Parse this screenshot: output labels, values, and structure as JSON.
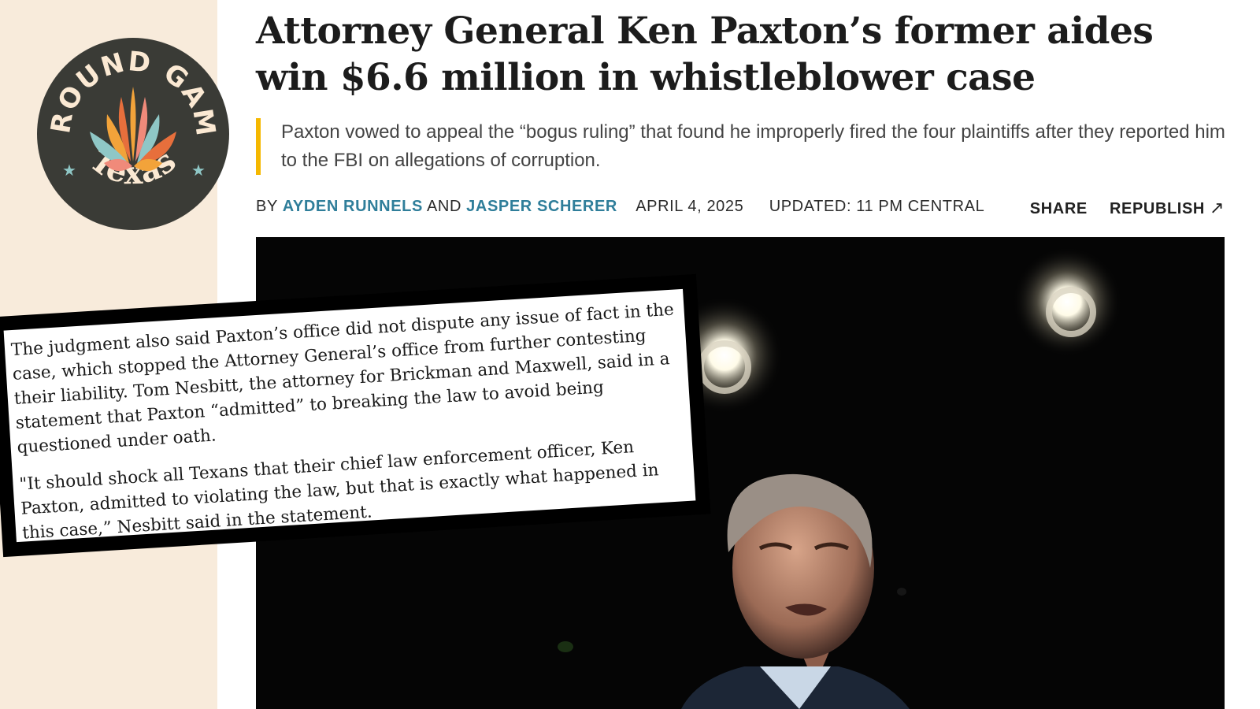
{
  "brand": {
    "logo_top_text": "GROUND GAME",
    "logo_bottom_text": "Texas",
    "background": "#f8ebdb",
    "logo_circle_color": "#3a3b36",
    "logo_text_color": "#fbe9d3",
    "star_color": "#8fc7c6"
  },
  "article": {
    "headline": "Attorney General Ken Paxton’s former aides win $6.6 million in whistleblower case",
    "dek": "Paxton vowed to appeal the “bogus ruling” that found he improperly fired the four plaintiffs after they reported him to the FBI on allegations of corruption.",
    "byline": {
      "by": "BY",
      "author1": "AYDEN RUNNELS",
      "and": "AND",
      "author2": "JASPER SCHERER",
      "date": "APRIL 4, 2025",
      "updated": "UPDATED: 11 PM CENTRAL"
    },
    "actions": {
      "share": "SHARE",
      "republish": "REPUBLISH",
      "republish_icon": "↗"
    },
    "accent_color": "#f5b800",
    "author_color": "#2f7e9a"
  },
  "quote_card": {
    "paragraph1": "The judgment also said Paxton’s office did not dispute any issue of fact in the case, which stopped the Attorney General’s office from further contesting their liability. Tom Nesbitt, the attorney for Brickman and Maxwell, said in a statement that Paxton “admitted” to breaking the law to avoid being questioned under oath.",
    "paragraph2": "\"It should shock all Texans that their chief law enforcement officer, Ken Paxton, admitted to violating the law, but that is exactly what happened in this case,” Nesbitt said in the statement."
  }
}
